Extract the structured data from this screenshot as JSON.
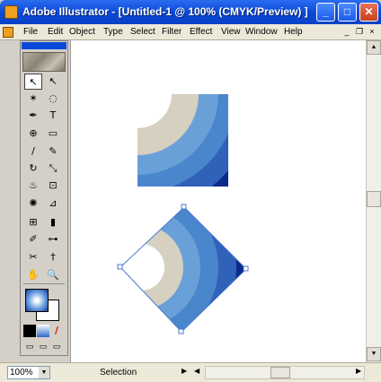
{
  "window": {
    "title": "Adobe Illustrator - [Untitled-1 @ 100% (CMYK/Preview) ]",
    "minimize_glyph": "_",
    "maximize_glyph": "□",
    "close_glyph": "✕"
  },
  "menu": {
    "items": [
      "File",
      "Edit",
      "Object",
      "Type",
      "Select",
      "Filter",
      "Effect",
      "View",
      "Window",
      "Help"
    ],
    "mdi_min": "_",
    "mdi_restore": "❐",
    "mdi_close": "×"
  },
  "status": {
    "zoom": "100%",
    "tool": "Selection"
  },
  "toolbox": {
    "tools": [
      {
        "name": "selection-tool-icon",
        "glyph": "↖"
      },
      {
        "name": "direct-selection-tool-icon",
        "glyph": "↖"
      },
      {
        "name": "magic-wand-tool-icon",
        "glyph": "✶"
      },
      {
        "name": "lasso-tool-icon",
        "glyph": "◌"
      },
      {
        "name": "pen-tool-icon",
        "glyph": "✒"
      },
      {
        "name": "type-tool-icon",
        "glyph": "T"
      },
      {
        "name": "line-tool-icon",
        "glyph": "⊕"
      },
      {
        "name": "rectangle-tool-icon",
        "glyph": "▭"
      },
      {
        "name": "paintbrush-tool-icon",
        "glyph": "/"
      },
      {
        "name": "pencil-tool-icon",
        "glyph": "✎"
      },
      {
        "name": "rotate-tool-icon",
        "glyph": "↻"
      },
      {
        "name": "scale-tool-icon",
        "glyph": "⤡"
      },
      {
        "name": "warp-tool-icon",
        "glyph": "♨"
      },
      {
        "name": "free-transform-tool-icon",
        "glyph": "⊡"
      },
      {
        "name": "symbol-sprayer-tool-icon",
        "glyph": "✺"
      },
      {
        "name": "graph-tool-icon",
        "glyph": "⊿"
      },
      {
        "name": "mesh-tool-icon",
        "glyph": "⊞"
      },
      {
        "name": "gradient-tool-icon",
        "glyph": "▮"
      },
      {
        "name": "eyedropper-tool-icon",
        "glyph": "✐"
      },
      {
        "name": "blend-tool-icon",
        "glyph": "⊶"
      },
      {
        "name": "slice-tool-icon",
        "glyph": "✂"
      },
      {
        "name": "scissors-tool-icon",
        "glyph": "†"
      },
      {
        "name": "hand-tool-icon",
        "glyph": "✋"
      },
      {
        "name": "zoom-tool-icon",
        "glyph": "🔍"
      }
    ],
    "none_glyph": "/",
    "screen_modes": [
      "▭",
      "▭",
      "▭"
    ]
  },
  "artwork": {
    "colors": [
      "#0b2a8a",
      "#2a5ab4",
      "#3f7ac8",
      "#6aa0d8",
      "#d6d0c0",
      "#ffffff"
    ]
  }
}
